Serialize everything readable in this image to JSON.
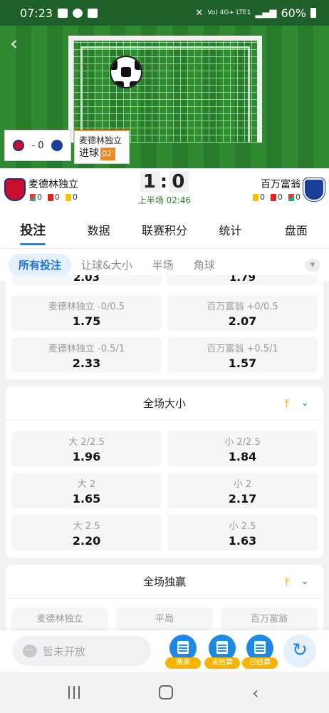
{
  "status_bar": {
    "time": "07:23",
    "network": "Vo) 4G+ LTE1",
    "battery": "60%"
  },
  "match_popup": {
    "mini_score": "- 0",
    "goal_team": "麦德林独立",
    "goal_label": "进球",
    "goal_minute": "02'"
  },
  "scoreboard": {
    "home": {
      "name": "麦德林独立",
      "corners": "0",
      "red": "0",
      "yellow": "0"
    },
    "away": {
      "name": "百万富翁",
      "corners": "0",
      "red": "0",
      "yellow": "0"
    },
    "home_score": "1",
    "separator": ":",
    "away_score": "0",
    "period": "上半场 02:46"
  },
  "tabs": [
    {
      "label": "投注",
      "active": true
    },
    {
      "label": "数据"
    },
    {
      "label": "联赛积分"
    },
    {
      "label": "统计"
    },
    {
      "label": "盘面"
    }
  ],
  "subtabs": [
    {
      "label": "所有投注",
      "active": true
    },
    {
      "label": "让球&大小"
    },
    {
      "label": "半场"
    },
    {
      "label": "角球"
    }
  ],
  "handicap_card": {
    "partial_top_left": "2.03",
    "partial_top_right": "1.79",
    "rows": [
      {
        "left_label": "麦德林独立 -0/0.5",
        "left_odds": "1.75",
        "right_label": "百万富翁 +0/0.5",
        "right_odds": "2.07"
      },
      {
        "left_label": "麦德林独立 -0.5/1",
        "left_odds": "2.33",
        "right_label": "百万富翁 +0.5/1",
        "right_odds": "1.57"
      }
    ]
  },
  "total_card": {
    "title": "全场大小",
    "rows": [
      {
        "left_label": "大 2/2.5",
        "left_odds": "1.96",
        "right_label": "小 2/2.5",
        "right_odds": "1.84"
      },
      {
        "left_label": "大 2",
        "left_odds": "1.65",
        "right_label": "小 2",
        "right_odds": "2.17"
      },
      {
        "left_label": "大 2.5",
        "left_odds": "2.20",
        "right_label": "小 2.5",
        "right_odds": "1.63"
      }
    ]
  },
  "winner_card": {
    "title": "全场独赢",
    "options": [
      "麦德林独立",
      "平局",
      "百万富翁"
    ]
  },
  "bottom_bar": {
    "input_placeholder": "暂未开放",
    "buttons": [
      "赛果",
      "未结算",
      "已结算"
    ]
  },
  "colors": {
    "accent": "#1e88e5",
    "goal_tag": "#f08a1c",
    "pitch": "#2f8a32",
    "period_text": "#2c7a2c"
  }
}
